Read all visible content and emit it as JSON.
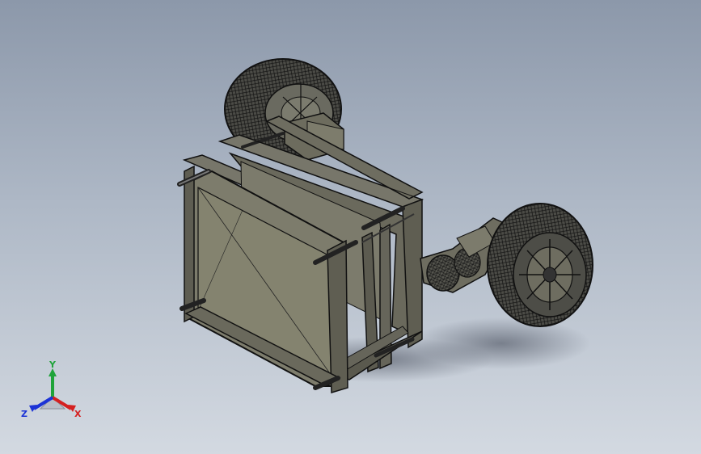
{
  "viewport": {
    "background_top": "#8c98aa",
    "background_bottom": "#d3d9e1"
  },
  "model": {
    "body_color": "#6e6d5e",
    "edge_color": "#111111",
    "panel_color": "#8a8a78",
    "tire_color": "#2a2a28"
  },
  "triad": {
    "x_label": "X",
    "y_label": "Y",
    "z_label": "Z",
    "x_color": "#d42020",
    "y_color": "#1fa33a",
    "z_color": "#1c33d6"
  }
}
